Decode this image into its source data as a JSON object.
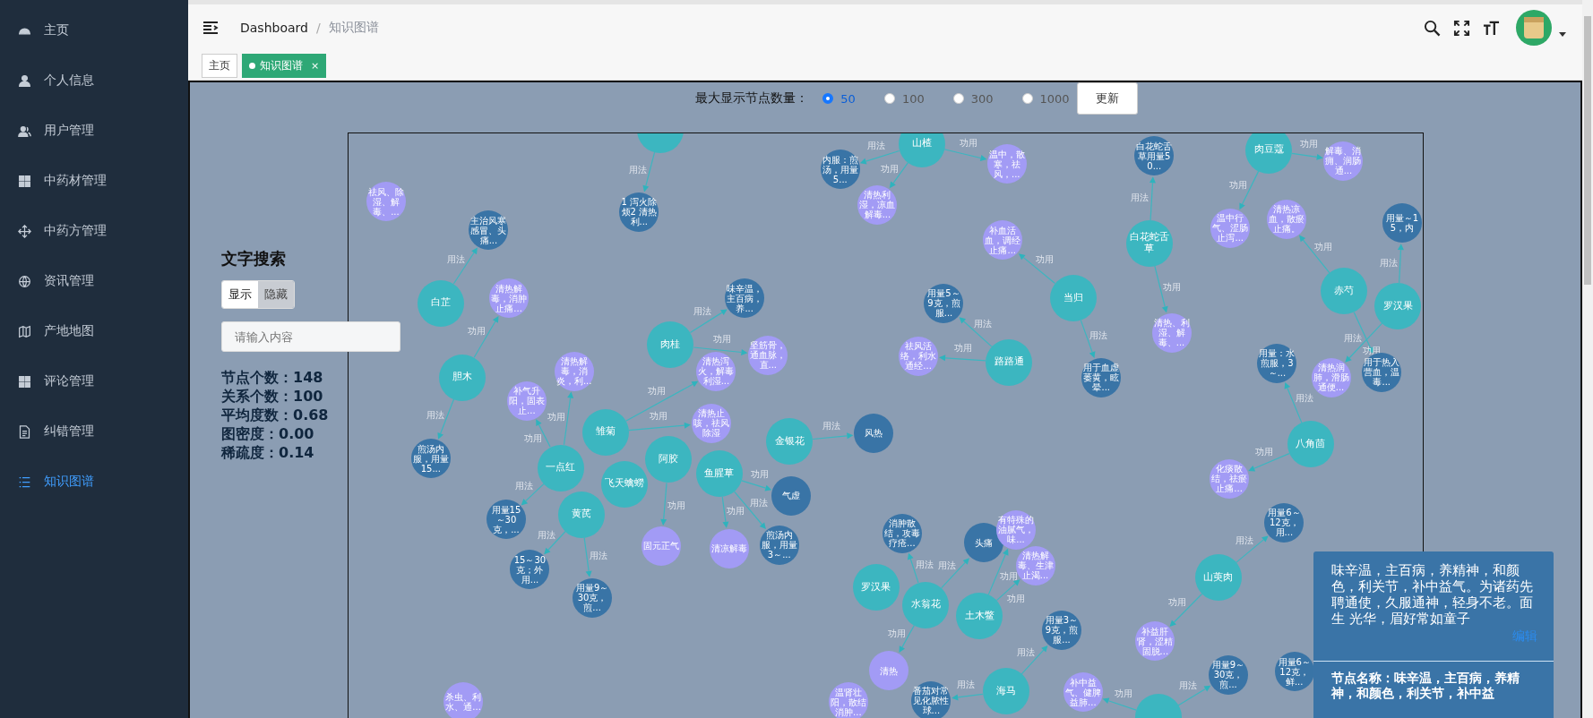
{
  "sidebar": {
    "items": [
      {
        "label": "主页",
        "selected": false
      },
      {
        "label": "个人信息",
        "selected": false
      },
      {
        "label": "用户管理",
        "selected": false
      },
      {
        "label": "中药材管理",
        "selected": false
      },
      {
        "label": "中药方管理",
        "selected": false
      },
      {
        "label": "资讯管理",
        "selected": false
      },
      {
        "label": "产地地图",
        "selected": false
      },
      {
        "label": "评论管理",
        "selected": false
      },
      {
        "label": "纠错管理",
        "selected": false
      },
      {
        "label": "知识图谱",
        "selected": true
      }
    ]
  },
  "header": {
    "breadcrumb": {
      "items": [
        "Dashboard",
        "知识图谱"
      ],
      "separator": "/"
    }
  },
  "tags": [
    {
      "label": "主页",
      "selected": false
    },
    {
      "label": "知识图谱",
      "selected": true,
      "close": "×"
    }
  ],
  "node_limit": {
    "label": "最大显示节点数量：",
    "options": [
      {
        "label": "50",
        "selected": true
      },
      {
        "label": "100",
        "selected": false
      },
      {
        "label": "300",
        "selected": false
      },
      {
        "label": "1000",
        "selected": false
      }
    ],
    "button": "更新"
  },
  "search": {
    "title": "文字搜索",
    "toggle": [
      {
        "label": "显示",
        "selected": true
      },
      {
        "label": "隐藏",
        "selected": false
      }
    ],
    "placeholder": "请输入内容",
    "stats": [
      "节点个数：148",
      "关系个数：100",
      "平均度数：0.68",
      "图密度：0.00",
      "稀疏度：0.14"
    ]
  },
  "graph": {
    "herbs": [
      {
        "relations": [
          {
            "label": "用法",
            "node": {
              "kind": "usage",
              "text": "1 泻火除烦2 清热利..."
            }
          }
        ]
      },
      {
        "name": "山楂",
        "relations": [
          {
            "label": "功用",
            "node": {
              "kind": "effect",
              "text": "温中，散寒，祛风，..."
            }
          },
          {
            "label": "功用",
            "node": {
              "kind": "effect",
              "text": "清热利湿，凉血解毒..."
            }
          },
          {
            "label": "用法",
            "node": {
              "kind": "usage",
              "text": "内服：煎汤，用量5..."
            }
          }
        ]
      },
      {
        "name": "白芷",
        "relations": [
          {
            "label": "用法",
            "node": {
              "kind": "usage",
              "text": "主治风寒感冒、头痛..."
            }
          }
        ]
      },
      {
        "name": "胆木",
        "relations": [
          {
            "label": "功用",
            "node": {
              "kind": "effect",
              "text": "清热解毒，消肿止痛..."
            }
          },
          {
            "label": "用法",
            "node": {
              "kind": "usage",
              "text": "煎汤内服，用量15..."
            }
          }
        ]
      },
      {
        "name": "肉桂",
        "relations": [
          {
            "label": "用法",
            "node": {
              "kind": "usage",
              "text": "味辛温，主百病，养..."
            }
          },
          {
            "label": "功用",
            "node": {
              "kind": "effect",
              "text": "坚筋骨，通血脉，直..."
            }
          }
        ]
      },
      {
        "name": "一点红",
        "relations": [
          {
            "label": "功用",
            "node": {
              "kind": "effect",
              "text": "清热解毒，消炎，利..."
            }
          },
          {
            "label": "功用",
            "node": {
              "kind": "effect",
              "text": "补气升阳，固表止..."
            }
          },
          {
            "label": "用法",
            "node": {
              "kind": "usage",
              "text": "用量15～30克，..."
            }
          }
        ]
      },
      {
        "name": "雏菊",
        "relations": [
          {
            "label": "功用",
            "node": {
              "kind": "effect",
              "text": "清热泻火，解毒利湿..."
            }
          },
          {
            "label": "功用",
            "node": {
              "kind": "effect",
              "text": "清热止咳，祛风除湿"
            }
          }
        ]
      },
      {
        "name": "飞天蠄蟧"
      },
      {
        "name": "黄芪",
        "relations": [
          {
            "label": "用法",
            "node": {
              "kind": "usage",
              "text": "15～30克；外用..."
            }
          },
          {
            "label": "用法",
            "node": {
              "kind": "usage",
              "text": "用量9～30克，煎..."
            }
          }
        ]
      },
      {
        "name": "阿胶",
        "relations": [
          {
            "label": "功用",
            "node": {
              "kind": "effect",
              "text": "固元正气"
            }
          }
        ]
      },
      {
        "name": "鱼腥草",
        "relations": [
          {
            "label": "功用",
            "node": {
              "kind": "usage",
              "text": "气虚"
            }
          },
          {
            "label": "功用",
            "node": {
              "kind": "effect",
              "text": "清凉解毒"
            }
          },
          {
            "label": "用法",
            "node": {
              "kind": "usage",
              "text": "煎汤内服，用量3～..."
            }
          }
        ]
      },
      {
        "name": "金银花",
        "relations": [
          {
            "label": "用法",
            "node": {
              "kind": "usage",
              "text": "风热"
            }
          }
        ]
      },
      {
        "name": "路路通",
        "relations": [
          {
            "label": "用法",
            "node": {
              "kind": "usage",
              "text": "用量5～9克，煎服..."
            }
          },
          {
            "label": "功用",
            "node": {
              "kind": "effect",
              "text": "祛风活络，利水通经..."
            }
          }
        ]
      },
      {
        "name": "当归",
        "relations": [
          {
            "label": "功用",
            "node": {
              "kind": "effect",
              "text": "补血活血，调经止痛..."
            }
          },
          {
            "label": "用法",
            "node": {
              "kind": "usage",
              "text": "用于血虚萎黄，眩晕..."
            }
          }
        ]
      },
      {
        "name": "白花蛇舌草",
        "relations": [
          {
            "label": "用法",
            "node": {
              "kind": "usage",
              "text": "白花蛇舌草用量50..."
            }
          },
          {
            "label": "功用",
            "node": {
              "kind": "effect",
              "text": "清热、利湿、解毒、..."
            }
          }
        ]
      },
      {
        "name": "肉豆蔻",
        "relations": [
          {
            "label": "功用",
            "node": {
              "kind": "effect",
              "text": "解毒、消痈、润肠通..."
            }
          },
          {
            "label": "功用",
            "node": {
              "kind": "effect",
              "text": "温中行气、涩肠止泻..."
            }
          }
        ]
      },
      {
        "name": "赤芍",
        "relations": [
          {
            "label": "功用",
            "node": {
              "kind": "effect",
              "text": "清热凉血，散瘀止痛。"
            }
          },
          {
            "label": "用法",
            "node": {
              "kind": "usage",
              "text": "用于热入营血，温毒..."
            }
          }
        ]
      },
      {
        "name": "罗汉果",
        "relations": [
          {
            "label": "用法",
            "node": {
              "kind": "usage",
              "text": "用量～15，内"
            }
          },
          {
            "label": "功用",
            "node": {
              "kind": "effect",
              "text": "清热润肺，滑肠通便..."
            }
          }
        ]
      },
      {
        "name": "八角茴",
        "relations": [
          {
            "label": "用法",
            "node": {
              "kind": "usage",
              "text": "用量：水煎服，3～..."
            }
          },
          {
            "label": "功用",
            "node": {
              "kind": "effect",
              "text": "化痰散结，祛瘀止痛..."
            }
          }
        ]
      },
      {
        "name": "山萸肉",
        "relations": [
          {
            "label": "用法",
            "node": {
              "kind": "usage",
              "text": "用量6～12克，用..."
            }
          },
          {
            "label": "功用",
            "node": {
              "kind": "effect",
              "text": "补益肝肾，涩精固脱..."
            }
          }
        ]
      },
      {
        "name": "水翁花",
        "relations": [
          {
            "label": "用法",
            "node": {
              "kind": "usage",
              "text": "消肿散结，攻毒疗疮..."
            }
          },
          {
            "label": "用法",
            "node": {
              "kind": "usage",
              "text": "头痛"
            }
          },
          {
            "label": "功用",
            "node": {
              "kind": "effect",
              "text": "清热"
            }
          }
        ]
      },
      {
        "name": "土木鳖",
        "relations": [
          {
            "label": "功用",
            "node": {
              "kind": "effect",
              "text": "有特殊的油腻气，味..."
            }
          },
          {
            "label": "功用",
            "node": {
              "kind": "effect",
              "text": "清热解毒、生津止渴..."
            }
          }
        ]
      },
      {
        "name": "罗汉果"
      },
      {
        "name": "海马",
        "relations": [
          {
            "label": "用法",
            "node": {
              "kind": "usage",
              "text": "用量3～9克，煎服..."
            }
          },
          {
            "label": "用法",
            "node": {
              "kind": "usage",
              "text": "番茄对常见化脓性球..."
            }
          }
        ]
      },
      {
        "relations": [
          {
            "label": "功用",
            "node": {
              "kind": "effect",
              "text": "补中益气、健脾益肺..."
            }
          },
          {
            "label": "用法",
            "node": {
              "kind": "usage",
              "text": "用量9～30克，煎..."
            }
          }
        ]
      }
    ],
    "loose_nodes": [
      {
        "kind": "effect",
        "text": "祛风、除湿、解毒、..."
      },
      {
        "kind": "effect",
        "text": "杀虫、利水、通..."
      },
      {
        "kind": "effect",
        "text": "温肾壮阳，散结消肿..."
      },
      {
        "kind": "usage",
        "text": "用量6～12克，鲜..."
      }
    ]
  },
  "detail_popup": {
    "text": "味辛温，主百病，养精神，和颜色，利关节，补中益气。为诸药先聘通使，久服通神，轻身不老。面生 光华，眉好常如童子",
    "edit_link": "编辑",
    "node_name": "节点名称：味辛温，主百病，养精神，和颜色，利关节，补中益"
  }
}
